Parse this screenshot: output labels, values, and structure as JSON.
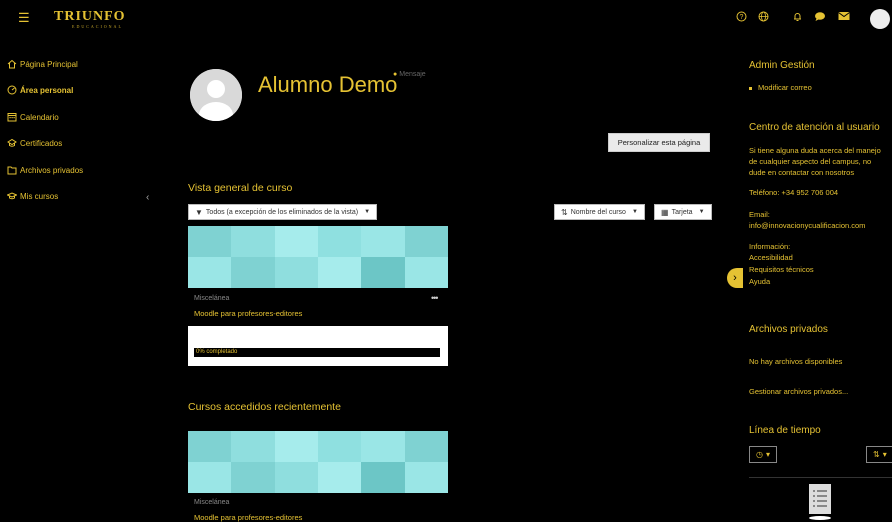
{
  "header": {
    "logo_text": "TRIUNFO",
    "logo_subtext": "EDUCACIONAL",
    "icons": [
      "menu-icon",
      "help-icon",
      "globe-icon",
      "bell-icon",
      "chat-icon",
      "mail-icon",
      "user-avatar"
    ]
  },
  "sidebar": {
    "items": [
      {
        "label": "Página Principal",
        "icon": "home-icon"
      },
      {
        "label": "Área personal",
        "icon": "dashboard-icon"
      },
      {
        "label": "Calendario",
        "icon": "calendar-icon"
      },
      {
        "label": "Certificados",
        "icon": "certificate-icon"
      },
      {
        "label": "Archivos privados",
        "icon": "files-icon"
      },
      {
        "label": "Mis cursos",
        "icon": "graduation-cap-icon"
      }
    ],
    "collapse_icon": "chevron-left-icon"
  },
  "profile": {
    "name": "Alumno Demo",
    "message_label": "Mensaje"
  },
  "main": {
    "customize_button": "Personalizar esta página",
    "overview": {
      "title": "Vista general de curso",
      "filter_label": "Todos (a excepción de los eliminados de la vista)",
      "sort_label": "Nombre del curso",
      "view_label": "Tarjeta"
    },
    "course": {
      "category": "Miscelánea",
      "name": "Moodle para profesores-editores",
      "progress_text": "0% completado",
      "progress": 0
    },
    "recent": {
      "title": "Cursos accedidos recientemente",
      "category": "Miscelánea",
      "name": "Moodle para profesores-editores"
    }
  },
  "right": {
    "admin": {
      "title": "Admin Gestión",
      "link": "Modificar correo"
    },
    "support": {
      "title": "Centro de atención al usuario",
      "lines": [
        "Si tiene alguna duda acerca del manejo",
        "de cualquier aspecto del campus, no",
        "dude en contactar con nosotros"
      ],
      "phone": "Teléfono: +34 952 706 004",
      "email_label": "Email:",
      "email": "info@innovacionycualificacion.com",
      "info_label": "Información:",
      "links": [
        "Accesibilidad",
        "Requisitos técnicos",
        "Ayuda"
      ]
    },
    "files": {
      "title": "Archivos privados",
      "empty": "No hay archivos disponibles",
      "manage": "Gestionar archivos privados..."
    },
    "timeline": {
      "title": "Línea de tiempo"
    }
  },
  "colors": {
    "accent": "#e5c233",
    "background": "#000000",
    "tile_a": "#7fd9d9",
    "tile_b": "#9ae6e6",
    "tile_c": "#6cc9c9"
  }
}
